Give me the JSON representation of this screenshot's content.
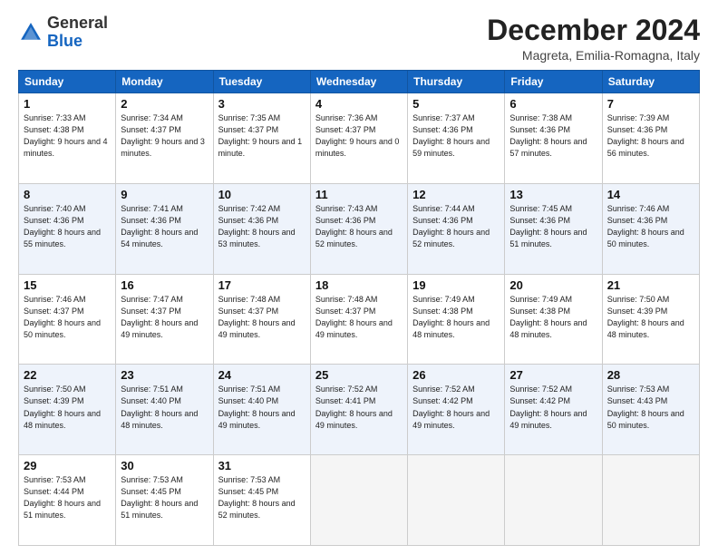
{
  "logo": {
    "general": "General",
    "blue": "Blue"
  },
  "title": "December 2024",
  "subtitle": "Magreta, Emilia-Romagna, Italy",
  "days_of_week": [
    "Sunday",
    "Monday",
    "Tuesday",
    "Wednesday",
    "Thursday",
    "Friday",
    "Saturday"
  ],
  "weeks": [
    [
      {
        "day": 1,
        "sunrise": "7:33 AM",
        "sunset": "4:38 PM",
        "daylight": "9 hours and 4 minutes."
      },
      {
        "day": 2,
        "sunrise": "7:34 AM",
        "sunset": "4:37 PM",
        "daylight": "9 hours and 3 minutes."
      },
      {
        "day": 3,
        "sunrise": "7:35 AM",
        "sunset": "4:37 PM",
        "daylight": "9 hours and 1 minute."
      },
      {
        "day": 4,
        "sunrise": "7:36 AM",
        "sunset": "4:37 PM",
        "daylight": "9 hours and 0 minutes."
      },
      {
        "day": 5,
        "sunrise": "7:37 AM",
        "sunset": "4:36 PM",
        "daylight": "8 hours and 59 minutes."
      },
      {
        "day": 6,
        "sunrise": "7:38 AM",
        "sunset": "4:36 PM",
        "daylight": "8 hours and 57 minutes."
      },
      {
        "day": 7,
        "sunrise": "7:39 AM",
        "sunset": "4:36 PM",
        "daylight": "8 hours and 56 minutes."
      }
    ],
    [
      {
        "day": 8,
        "sunrise": "7:40 AM",
        "sunset": "4:36 PM",
        "daylight": "8 hours and 55 minutes."
      },
      {
        "day": 9,
        "sunrise": "7:41 AM",
        "sunset": "4:36 PM",
        "daylight": "8 hours and 54 minutes."
      },
      {
        "day": 10,
        "sunrise": "7:42 AM",
        "sunset": "4:36 PM",
        "daylight": "8 hours and 53 minutes."
      },
      {
        "day": 11,
        "sunrise": "7:43 AM",
        "sunset": "4:36 PM",
        "daylight": "8 hours and 52 minutes."
      },
      {
        "day": 12,
        "sunrise": "7:44 AM",
        "sunset": "4:36 PM",
        "daylight": "8 hours and 52 minutes."
      },
      {
        "day": 13,
        "sunrise": "7:45 AM",
        "sunset": "4:36 PM",
        "daylight": "8 hours and 51 minutes."
      },
      {
        "day": 14,
        "sunrise": "7:46 AM",
        "sunset": "4:36 PM",
        "daylight": "8 hours and 50 minutes."
      }
    ],
    [
      {
        "day": 15,
        "sunrise": "7:46 AM",
        "sunset": "4:37 PM",
        "daylight": "8 hours and 50 minutes."
      },
      {
        "day": 16,
        "sunrise": "7:47 AM",
        "sunset": "4:37 PM",
        "daylight": "8 hours and 49 minutes."
      },
      {
        "day": 17,
        "sunrise": "7:48 AM",
        "sunset": "4:37 PM",
        "daylight": "8 hours and 49 minutes."
      },
      {
        "day": 18,
        "sunrise": "7:48 AM",
        "sunset": "4:37 PM",
        "daylight": "8 hours and 49 minutes."
      },
      {
        "day": 19,
        "sunrise": "7:49 AM",
        "sunset": "4:38 PM",
        "daylight": "8 hours and 48 minutes."
      },
      {
        "day": 20,
        "sunrise": "7:49 AM",
        "sunset": "4:38 PM",
        "daylight": "8 hours and 48 minutes."
      },
      {
        "day": 21,
        "sunrise": "7:50 AM",
        "sunset": "4:39 PM",
        "daylight": "8 hours and 48 minutes."
      }
    ],
    [
      {
        "day": 22,
        "sunrise": "7:50 AM",
        "sunset": "4:39 PM",
        "daylight": "8 hours and 48 minutes."
      },
      {
        "day": 23,
        "sunrise": "7:51 AM",
        "sunset": "4:40 PM",
        "daylight": "8 hours and 48 minutes."
      },
      {
        "day": 24,
        "sunrise": "7:51 AM",
        "sunset": "4:40 PM",
        "daylight": "8 hours and 49 minutes."
      },
      {
        "day": 25,
        "sunrise": "7:52 AM",
        "sunset": "4:41 PM",
        "daylight": "8 hours and 49 minutes."
      },
      {
        "day": 26,
        "sunrise": "7:52 AM",
        "sunset": "4:42 PM",
        "daylight": "8 hours and 49 minutes."
      },
      {
        "day": 27,
        "sunrise": "7:52 AM",
        "sunset": "4:42 PM",
        "daylight": "8 hours and 49 minutes."
      },
      {
        "day": 28,
        "sunrise": "7:53 AM",
        "sunset": "4:43 PM",
        "daylight": "8 hours and 50 minutes."
      }
    ],
    [
      {
        "day": 29,
        "sunrise": "7:53 AM",
        "sunset": "4:44 PM",
        "daylight": "8 hours and 51 minutes."
      },
      {
        "day": 30,
        "sunrise": "7:53 AM",
        "sunset": "4:45 PM",
        "daylight": "8 hours and 51 minutes."
      },
      {
        "day": 31,
        "sunrise": "7:53 AM",
        "sunset": "4:45 PM",
        "daylight": "8 hours and 52 minutes."
      },
      null,
      null,
      null,
      null
    ]
  ]
}
